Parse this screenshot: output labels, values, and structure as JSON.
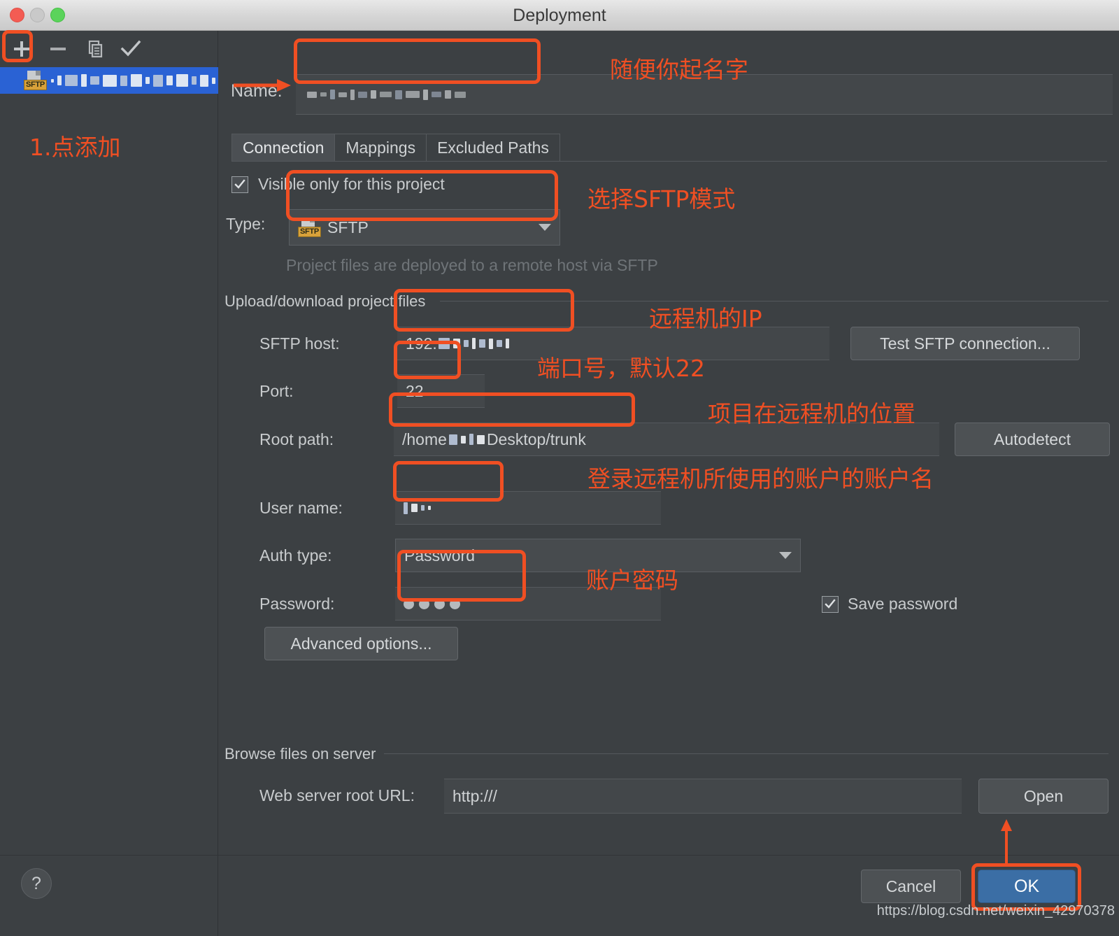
{
  "window": {
    "title": "Deployment",
    "traffic_lights": [
      "close",
      "minimize",
      "zoom"
    ]
  },
  "sidebar": {
    "toolbar": [
      {
        "name": "add",
        "icon": "plus-icon",
        "highlighted": true
      },
      {
        "name": "remove",
        "icon": "minus-icon",
        "highlighted": false
      },
      {
        "name": "copy",
        "icon": "copy-icon",
        "highlighted": false
      },
      {
        "name": "set-default",
        "icon": "check-icon",
        "highlighted": false
      }
    ],
    "items": [
      {
        "label": "",
        "icon": "sftp-server-icon",
        "selected": true,
        "redacted": true
      }
    ],
    "annotation": "1.点添加"
  },
  "form": {
    "name_label": "Name:",
    "name_value": "",
    "tabs": [
      {
        "label": "Connection",
        "active": true
      },
      {
        "label": "Mappings",
        "active": false
      },
      {
        "label": "Excluded Paths",
        "active": false
      }
    ],
    "visible_only_label": "Visible only for this project",
    "visible_only_checked": true,
    "type_label": "Type:",
    "type_value": "SFTP",
    "type_icon": "sftp-icon",
    "type_hint": "Project files are deployed to a remote host via SFTP",
    "upload_section_title": "Upload/download project files",
    "sftp_host_label": "SFTP host:",
    "sftp_host_value": "192.",
    "test_connection_label": "Test SFTP connection...",
    "port_label": "Port:",
    "port_value": "22",
    "root_path_label": "Root path:",
    "root_path_value": "/home",
    "root_path_value_tail": "Desktop/trunk",
    "autodetect_label": "Autodetect",
    "user_name_label": "User name:",
    "user_name_value": "",
    "auth_type_label": "Auth type:",
    "auth_type_value": "Password",
    "password_label": "Password:",
    "password_value": "••••",
    "save_password_label": "Save password",
    "save_password_checked": true,
    "advanced_options_label": "Advanced options...",
    "browse_section_title": "Browse files on server",
    "web_server_url_label": "Web server root URL:",
    "web_server_url_value": "http:///",
    "open_label": "Open"
  },
  "footer": {
    "help_label": "?",
    "cancel_label": "Cancel",
    "ok_label": "OK"
  },
  "annotations": {
    "name": "随便你起名字",
    "type": "选择SFTP模式",
    "host": "远程机的IP",
    "port": "端口号，默认22",
    "root_path": "项目在远程机的位置",
    "user_name": "登录远程机所使用的账户的账户名",
    "password": "账户密码"
  },
  "watermark": "https://blog.csdn.net/weixin_42970378",
  "colors": {
    "accent_annotation": "#f04f23",
    "window_bg": "#3c4043",
    "selection_blue": "#2a62d4",
    "primary_button": "#3b6ea5"
  }
}
